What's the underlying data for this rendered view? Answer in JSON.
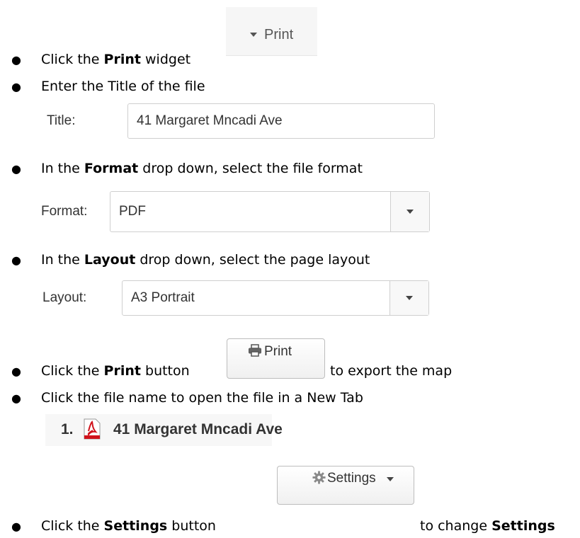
{
  "steps": [
    {
      "pre": "Click the ",
      "bold": "Print",
      "post": " widget"
    },
    {
      "text": "Enter the Title of the file"
    },
    {
      "pre": "In the ",
      "bold": "Format",
      "post": " drop down, select the file format"
    },
    {
      "pre": "In the ",
      "bold": "Layout",
      "post": " drop down, select the page layout"
    },
    {
      "pre": "Click the ",
      "bold": "Print",
      "post": " button"
    },
    {
      "post_after_button": "to export the map"
    },
    {
      "text": "Click the file name to open the file in a New Tab"
    },
    {
      "pre": "Click the ",
      "bold": "Settings",
      "post": " button",
      "after": "to change ",
      "after_bold": "Settings"
    }
  ],
  "print_widget": {
    "label": "Print",
    "icon": "caret-down-icon"
  },
  "title_field": {
    "label": "Title:",
    "value": "41 Margaret Mncadi Ave"
  },
  "format_field": {
    "label": "Format:",
    "value": "PDF"
  },
  "layout_field": {
    "label": "Layout:",
    "value": "A3 Portrait"
  },
  "print_button": {
    "label": "Print",
    "icon": "printer-icon"
  },
  "result": {
    "index": "1.",
    "file_name": "41 Margaret Mncadi Ave",
    "icon": "pdf-icon"
  },
  "settings_button": {
    "label": "Settings",
    "icon": "gear-icon"
  }
}
